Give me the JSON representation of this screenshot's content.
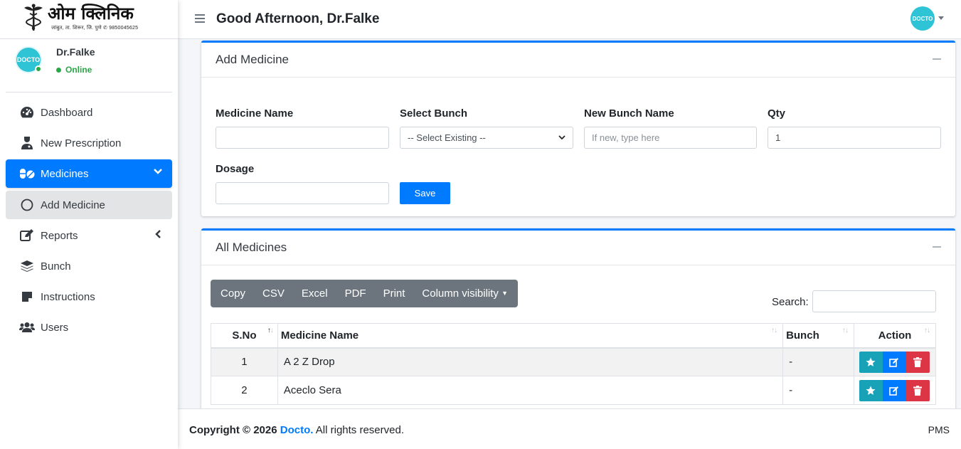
{
  "brand": {
    "name": "ओम क्लिनिक",
    "subtitle": "जांबुत, ता. शिरूर, जि. पुणे ✆ 9850045625"
  },
  "user": {
    "name": "Dr.Falke",
    "status": "Online",
    "avatar_text": "DOCTO"
  },
  "sidebar": {
    "items": [
      {
        "label": "Dashboard",
        "icon": "tachometer-icon"
      },
      {
        "label": "New Prescription",
        "icon": "user-doctor-icon"
      },
      {
        "label": "Medicines",
        "icon": "pills-icon",
        "active": true
      },
      {
        "label": "Add Medicine",
        "icon": "circle-icon",
        "sub": true
      },
      {
        "label": "Reports",
        "icon": "edit-icon"
      },
      {
        "label": "Bunch",
        "icon": "layers-icon"
      },
      {
        "label": "Instructions",
        "icon": "sticky-note-icon"
      },
      {
        "label": "Users",
        "icon": "users-icon"
      }
    ]
  },
  "header": {
    "greeting": "Good Afternoon, Dr.Falke"
  },
  "add_medicine": {
    "title": "Add Medicine",
    "medicine_name_label": "Medicine Name",
    "select_bunch_label": "Select Bunch",
    "select_bunch_value": "-- Select Existing --",
    "new_bunch_label": "New Bunch Name",
    "new_bunch_placeholder": "If new, type here",
    "qty_label": "Qty",
    "qty_value": "1",
    "dosage_label": "Dosage",
    "save_label": "Save"
  },
  "all_medicines": {
    "title": "All Medicines",
    "buttons": [
      "Copy",
      "CSV",
      "Excel",
      "PDF",
      "Print",
      "Column visibility"
    ],
    "search_label": "Search:",
    "columns": [
      "S.No",
      "Medicine Name",
      "Bunch",
      "Action"
    ],
    "rows": [
      {
        "sno": "1",
        "name": "A 2 Z Drop",
        "bunch": "-"
      },
      {
        "sno": "2",
        "name": "Aceclo Sera",
        "bunch": "-"
      }
    ]
  },
  "footer": {
    "copyright": "Copyright © 2026",
    "brand": "Docto.",
    "rights": "All rights reserved.",
    "version": "PMS"
  },
  "colors": {
    "primary": "#007bff",
    "success": "#28a745",
    "info": "#17a2b8",
    "danger": "#dc3545",
    "secondary": "#6c757d",
    "avatar": "#2ec4d6"
  }
}
